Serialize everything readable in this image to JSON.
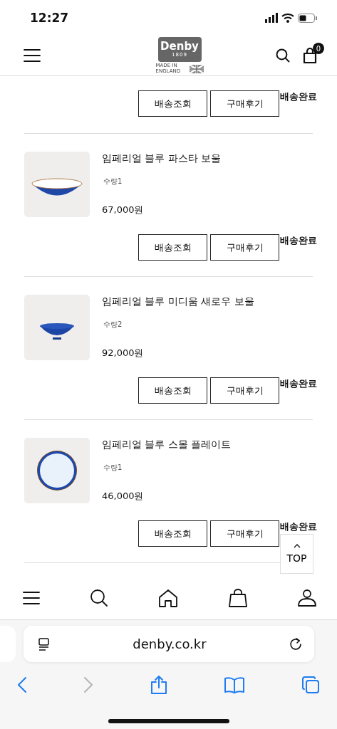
{
  "status_bar": {
    "time": "12:27"
  },
  "header": {
    "logo": {
      "brand": "Denby",
      "year": "1809",
      "origin": "MADE IN ENGLAND"
    },
    "cart_count": "0"
  },
  "orders": [
    {
      "buttons": [
        "배송조회",
        "구매후기"
      ],
      "status": "배송완료"
    },
    {
      "name": "임페리얼 블루 파스타 보울",
      "quantity": "수량1",
      "price": "67,000원",
      "buttons": [
        "배송조회",
        "구매후기"
      ],
      "status": "배송완료"
    },
    {
      "name": "임페리얼 블루 미디움 섀로우 보울",
      "quantity": "수량2",
      "price": "92,000원",
      "buttons": [
        "배송조회",
        "구매후기"
      ],
      "status": "배송완료"
    },
    {
      "name": "임페리얼 블루 스몰 플레이트",
      "quantity": "수량1",
      "price": "46,000원",
      "buttons": [
        "배송조회",
        "구매후기"
      ],
      "status": "배송완료"
    }
  ],
  "top_button": {
    "label": "TOP"
  },
  "bottom_nav": [
    {
      "kind": "menu"
    },
    {
      "kind": "search"
    },
    {
      "kind": "home"
    },
    {
      "kind": "bag"
    },
    {
      "kind": "user"
    }
  ],
  "browser": {
    "url": "denby.co.kr",
    "toolbar": [
      {
        "kind": "back",
        "disabled": false
      },
      {
        "kind": "forward",
        "disabled": true
      },
      {
        "kind": "share",
        "disabled": false
      },
      {
        "kind": "bookmarks",
        "disabled": false
      },
      {
        "kind": "tabs",
        "disabled": false
      }
    ]
  }
}
